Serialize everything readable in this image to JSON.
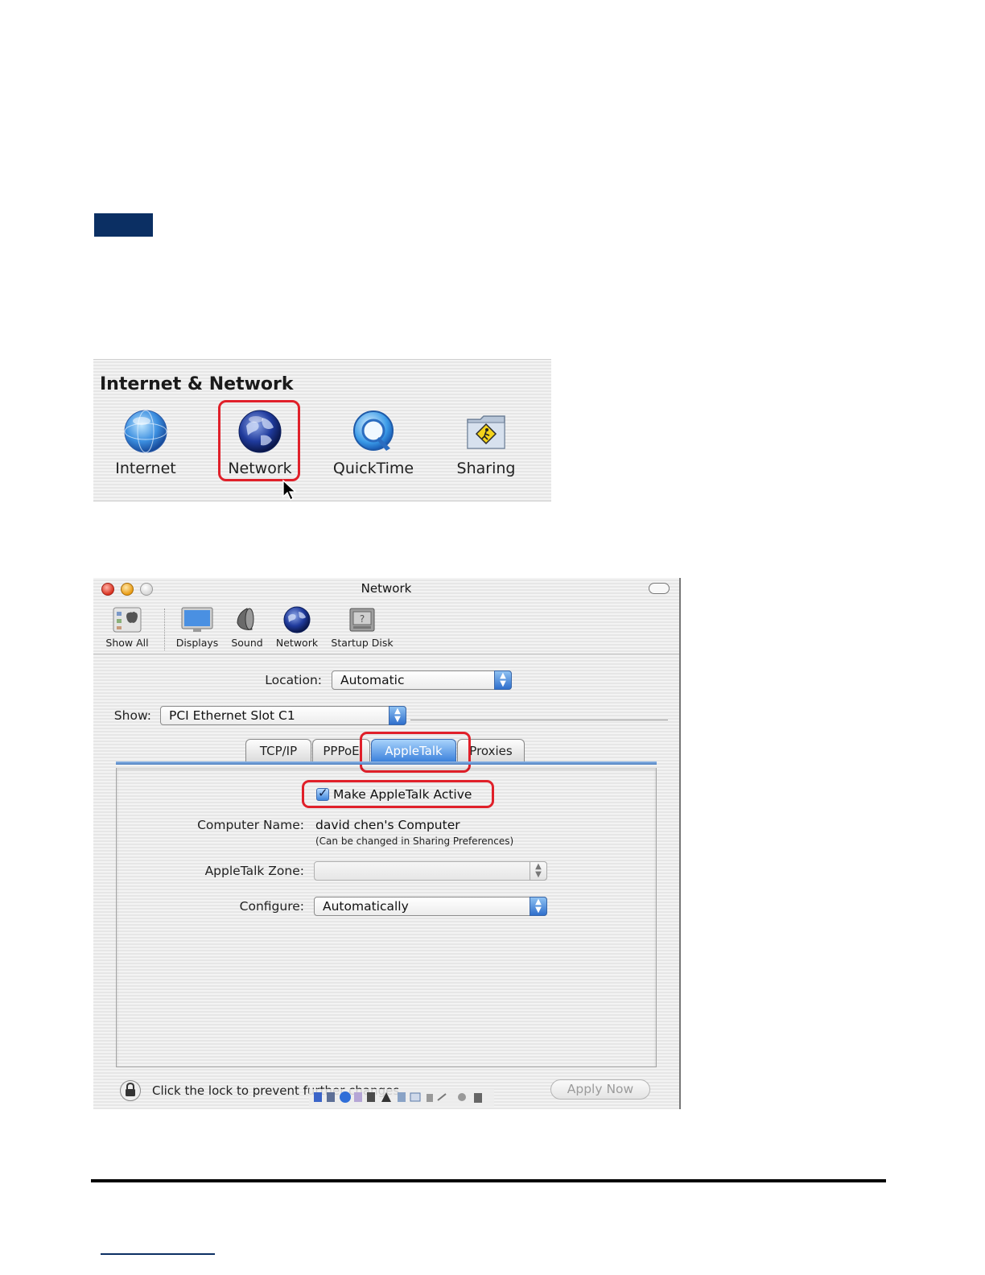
{
  "prefs_panel": {
    "section_title": "Internet & Network",
    "items": [
      {
        "label": "Internet",
        "icon": "internet-globe-icon"
      },
      {
        "label": "Network",
        "icon": "network-globe-icon"
      },
      {
        "label": "QuickTime",
        "icon": "quicktime-icon"
      },
      {
        "label": "Sharing",
        "icon": "sharing-folder-icon"
      }
    ],
    "highlighted": "Network"
  },
  "network_window": {
    "title": "Network",
    "toolbar": [
      {
        "label": "Show All",
        "icon": "show-all-icon"
      },
      {
        "label": "Displays",
        "icon": "displays-icon"
      },
      {
        "label": "Sound",
        "icon": "sound-icon"
      },
      {
        "label": "Network",
        "icon": "network-icon"
      },
      {
        "label": "Startup Disk",
        "icon": "startup-disk-icon"
      }
    ],
    "location": {
      "label": "Location:",
      "value": "Automatic"
    },
    "show": {
      "label": "Show:",
      "value": "PCI Ethernet Slot C1"
    },
    "tabs": [
      {
        "label": "TCP/IP",
        "active": false
      },
      {
        "label": "PPPoE",
        "active": false
      },
      {
        "label": "AppleTalk",
        "active": true
      },
      {
        "label": "Proxies",
        "active": false
      }
    ],
    "appletalk": {
      "checkbox_label": "Make AppleTalk Active",
      "checked": true,
      "computer_name_label": "Computer Name:",
      "computer_name": "david chen's Computer",
      "computer_name_hint": "(Can be changed in Sharing Preferences)",
      "zone_label": "AppleTalk Zone:",
      "zone_value": "",
      "configure_label": "Configure:",
      "configure_value": "Automatically"
    },
    "lock_text": "Click the lock to prevent further changes.",
    "apply_button": "Apply Now"
  },
  "colors": {
    "highlight_red": "#e0202a",
    "accent_blue": "#3c82dc",
    "header_block": "#0b2f63"
  }
}
